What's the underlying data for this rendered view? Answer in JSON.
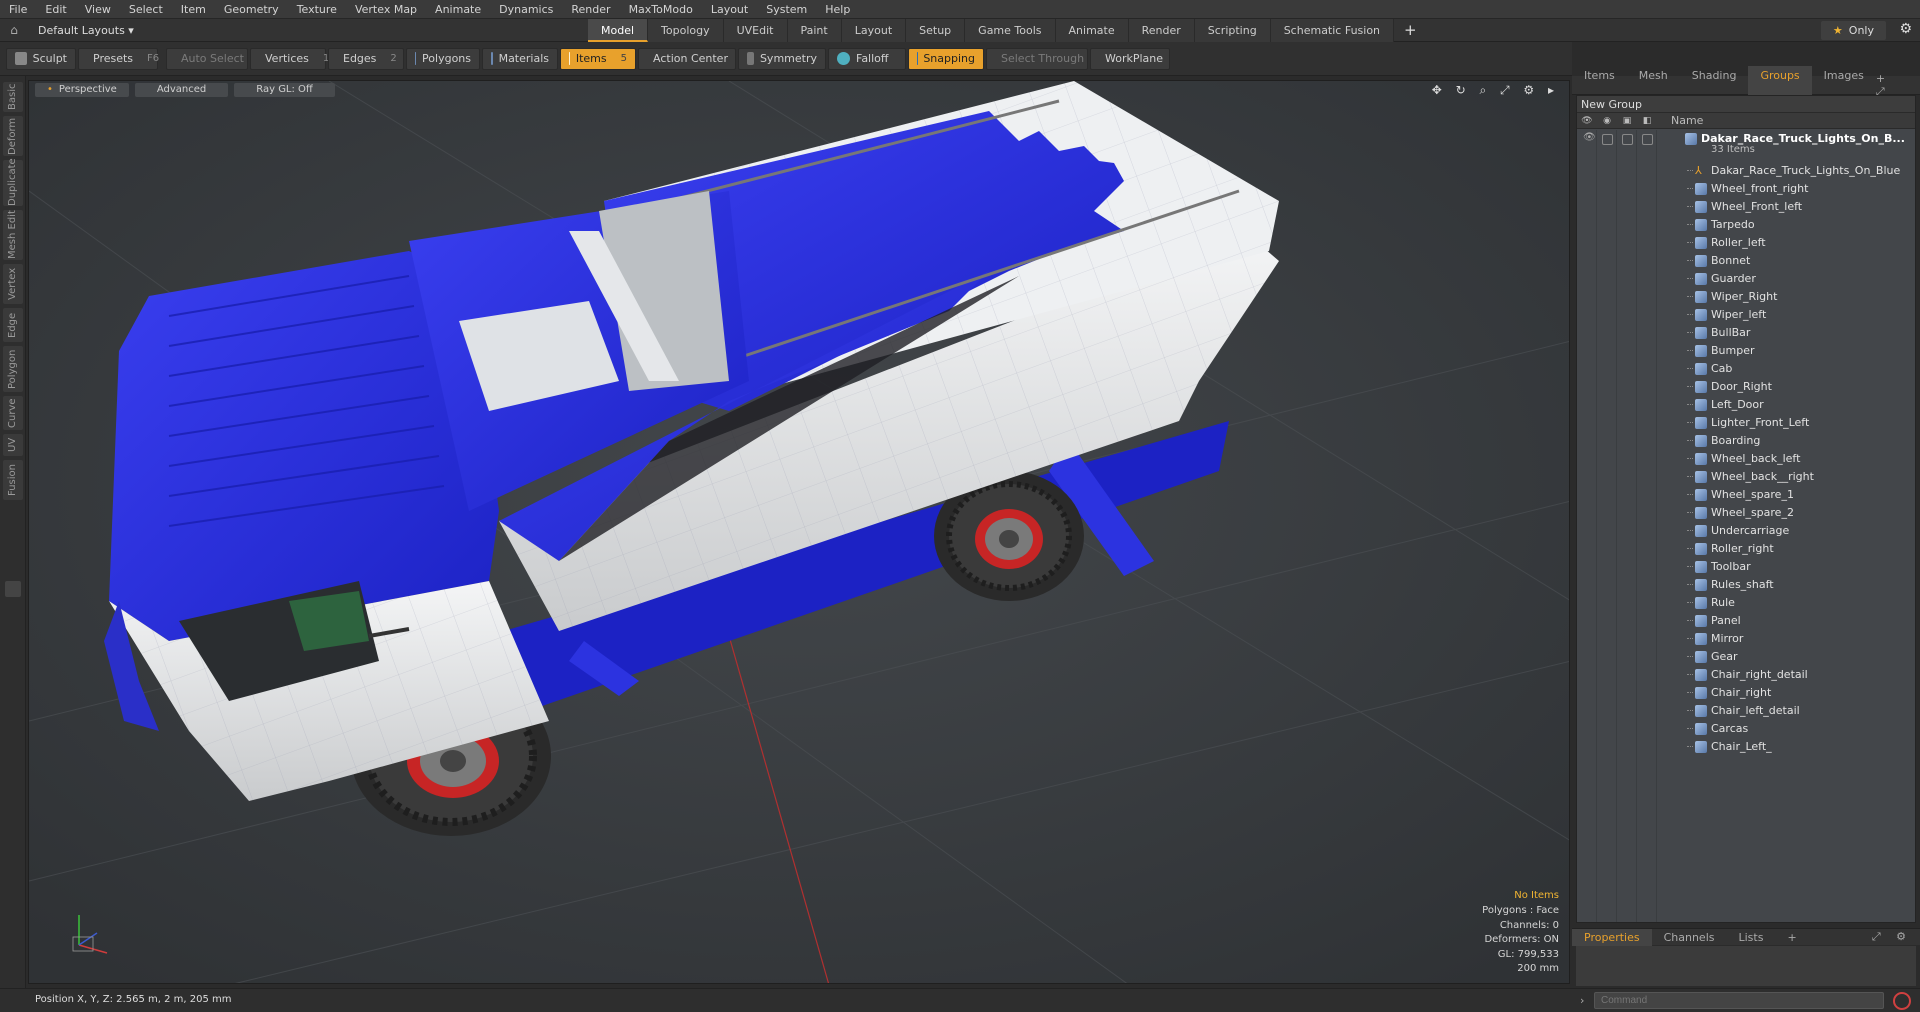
{
  "menu": [
    "File",
    "Edit",
    "View",
    "Select",
    "Item",
    "Geometry",
    "Texture",
    "Vertex Map",
    "Animate",
    "Dynamics",
    "Render",
    "MaxToModo",
    "Layout",
    "System",
    "Help"
  ],
  "layouts_label": "Default Layouts ▾",
  "tabs": [
    "Model",
    "Topology",
    "UVEdit",
    "Paint",
    "Layout",
    "Setup",
    "Game Tools",
    "Animate",
    "Render",
    "Scripting",
    "Schematic Fusion"
  ],
  "active_tab": "Model",
  "only_label": "Only",
  "toolbar": {
    "sculpt": "Sculpt",
    "presets": "Presets",
    "presets_key": "F6",
    "auto_select": "Auto Select",
    "vertices": "Vertices",
    "vertices_num": "1",
    "edges": "Edges",
    "edges_num": "2",
    "polygons": "Polygons",
    "materials": "Materials",
    "items": "Items",
    "items_num": "5",
    "action_center": "Action Center",
    "symmetry": "Symmetry",
    "falloff": "Falloff",
    "snapping": "Snapping",
    "select_through": "Select Through",
    "workplane": "WorkPlane"
  },
  "left_tabs": [
    "Basic",
    "Deform",
    "Duplicate",
    "Mesh Edit",
    "Vertex",
    "Edge",
    "Polygon",
    "Curve",
    "UV",
    "Fusion"
  ],
  "viewport": {
    "view": "Perspective",
    "shading": "Advanced",
    "raygl": "Ray GL: Off",
    "info": {
      "no_items": "No Items",
      "polygons": "Polygons : Face",
      "channels": "Channels: 0",
      "deformers": "Deformers: ON",
      "gl": "GL: 799,533",
      "size": "200 mm"
    }
  },
  "right_panel": {
    "tabs": [
      "Items",
      "Mesh ...",
      "Shading",
      "Groups",
      "Images"
    ],
    "active": "Groups",
    "new_group": "New Group",
    "col_name": "Name",
    "group_name": "Dakar_Race_Truck_Lights_On_B...",
    "group_count": "33 Items",
    "items": [
      "Dakar_Race_Truck_Lights_On_Blue",
      "Wheel_front_right",
      "Wheel_Front_left",
      "Tarpedo",
      "Roller_left",
      "Bonnet",
      "Guarder",
      "Wiper_Right",
      "Wiper_left",
      "BullBar",
      "Bumper",
      "Cab",
      "Door_Right",
      "Left_Door",
      "Lighter_Front_Left",
      "Boarding",
      "Wheel_back_left",
      "Wheel_back__right",
      "Wheel_spare_1",
      "Wheel_spare_2",
      "Undercarriage",
      "Roller_right",
      "Toolbar",
      "Rules_shaft",
      "Rule",
      "Panel",
      "Mirror",
      "Gear",
      "Chair_right_detail",
      "Chair_right",
      "Chair_left_detail",
      "Carcas",
      "Chair_Left_"
    ]
  },
  "bottom_tabs": [
    "Properties",
    "Channels",
    "Lists"
  ],
  "status": {
    "position": "Position X, Y, Z:   2.565 m, 2 m, 205 mm",
    "command_placeholder": "Command"
  }
}
